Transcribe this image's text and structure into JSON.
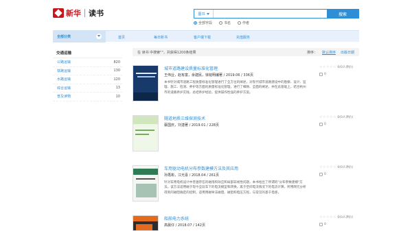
{
  "header": {
    "brand": "新华",
    "app_name": "读书",
    "search": {
      "scope": "图书",
      "placeholder": "",
      "button": "搜索",
      "options": [
        "全部字段",
        "书名",
        "作者"
      ]
    }
  },
  "nav": {
    "category": "全部分类",
    "items": [
      "首页",
      "每日新书",
      "客户端下载",
      "充值服务"
    ]
  },
  "sidebar": {
    "title": "交通运输",
    "items": [
      {
        "label": "公路运输",
        "count": "820"
      },
      {
        "label": "铁路运输",
        "count": "130"
      },
      {
        "label": "水路运输",
        "count": "120"
      },
      {
        "label": "综合运输",
        "count": "13"
      },
      {
        "label": "普及读物",
        "count": "10"
      }
    ]
  },
  "results": {
    "summary": "在 读书 中搜索\"\"，共获得1200条结果",
    "sort_label": "排序：",
    "sort_options": [
      "默认排序",
      "出版日期"
    ]
  },
  "books": [
    {
      "title": "城市道路建设质量标准化管理",
      "meta": "王伟业，赵有富，余建民，徐铭明编著 / 2019.06 / 336页",
      "desc": "本书针对城市道路工程质量标准化管理进行了全方位的阐述，对现代城市道路建设中的勘察、设计、监理、施工、检测、养护等方面的质量标准化管理，进行了细致、全面的阐述，并在此基础上，结合杭州市的道路养护实践，总结养护经验，提供操作性强的养护方案。",
      "rating": "0(0人评价)",
      "fav": "0",
      "cover": "cv1"
    },
    {
      "title": "隧道地质三维探测技术",
      "meta": "蔡国庆，刘湛著 / 2019.01 / 228页",
      "desc": "",
      "rating": "0(0人评价)",
      "fav": "0",
      "cover": "cv2"
    },
    {
      "title": "车用驱动电机分布参数建模方法及其应用",
      "meta": "孙再彬，江光喜 / 2018.04 / 261页",
      "desc": "针对车用电机设计中普遍存在的磁饱和效应和局部非线性问题，本书给出了所谓的\"分布参数建模\"方法。该方法适用磁于现今全段车下的电流模型和转换，再于空间电流情况下的电流计算，所用网元分析得到的磁阻确定的控制，适用用磁导法磁阻、磁阻和电压方程，与常见的基于电感，",
      "rating": "0(0人评价)",
      "fav": "0",
      "cover": "cv3"
    },
    {
      "title": "船舶电力系统",
      "meta": "高晨仔 / 2018.07 / 142页",
      "desc": "",
      "rating": "0(0人评价)",
      "fav": "0",
      "cover": "cv4"
    }
  ]
}
